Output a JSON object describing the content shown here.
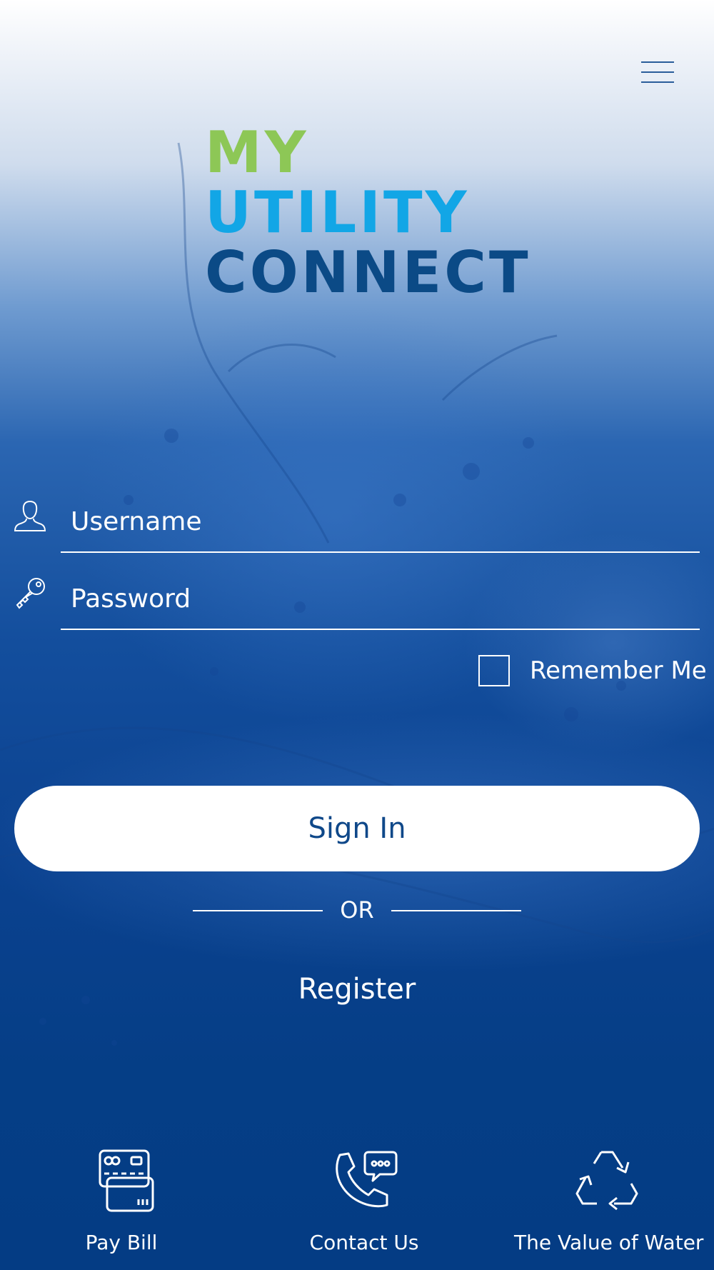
{
  "header": {
    "menu_icon": "hamburger-menu-icon"
  },
  "logo": {
    "line1": "MY",
    "line2": "UTILITY",
    "line3": "CONNECT",
    "colors": {
      "my": "#8dc756",
      "utility": "#12a6e6",
      "connect": "#0b4a86"
    }
  },
  "login": {
    "username": {
      "icon": "user-icon",
      "value": "",
      "placeholder": "Username"
    },
    "password": {
      "icon": "key-icon",
      "value": "",
      "placeholder": "Password"
    },
    "remember_me": {
      "label": "Remember Me",
      "checked": false
    },
    "sign_in_label": "Sign In",
    "or_label": "OR",
    "register_label": "Register"
  },
  "bottom_nav": [
    {
      "label": "Pay Bill",
      "icon": "credit-card-icon"
    },
    {
      "label": "Contact Us",
      "icon": "phone-chat-icon"
    },
    {
      "label": "The Value of Water",
      "icon": "recycle-icon"
    }
  ],
  "colors": {
    "background": "#0a3f86",
    "button_bg": "#ffffff",
    "button_text": "#0f4889"
  }
}
